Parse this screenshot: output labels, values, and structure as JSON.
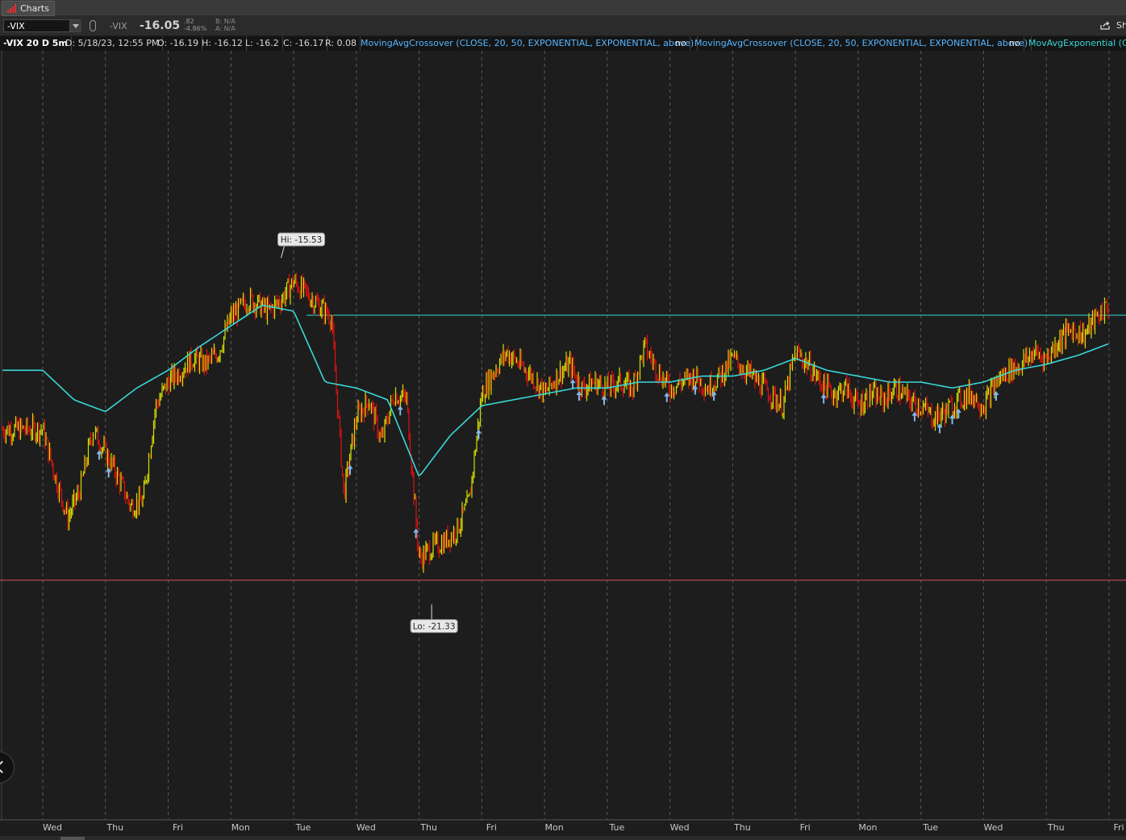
{
  "app": {
    "tab_label": "Charts"
  },
  "toolbar": {
    "symbol_value": "-VIX",
    "symbol_short": "-VIX",
    "last_price": "-16.05",
    "change_abs": ".82",
    "change_pct": "-4.86%",
    "bid": "B: N/A",
    "ask": "A: N/A",
    "share_label": "Sh"
  },
  "legend": {
    "title": "-VIX 20 D 5m",
    "date": "D: 5/18/23, 12:55 PM",
    "open": "O: -16.19",
    "high": "H: -16.12",
    "low": "L: -16.2",
    "close": "C: -16.17",
    "range": "R: 0.08",
    "study1": "MovingAvgCrossover (CLOSE, 20, 50, EXPONENTIAL, EXPONENTIAL, above)",
    "study1_flag": "no",
    "study2": "MovingAvgCrossover (CLOSE, 20, 50, EXPONENTIAL, EXPONENTIAL, above)",
    "study2_flag": "no",
    "study3": "MovAvgExponential (CL"
  },
  "colors": {
    "background": "#1d1d1d",
    "candle_up": "#d4e000",
    "candle_down": "#e01010",
    "moving_average": "#3ad7d7",
    "resistance_line": "#3ad7d7",
    "support_line": "#e05050",
    "signal_arrow": "#7fb8ee",
    "grid": "#5a5a5a"
  },
  "chart_data": {
    "type": "candlestick-line",
    "title": "-VIX 20 D 5m",
    "xlabel": "",
    "ylabel": "",
    "ylim": [
      -25.0,
      -12.0
    ],
    "grid": {
      "vertical_day_separators": true,
      "horizontal": false
    },
    "x_ticks": [
      "Wed",
      "Thu",
      "Fri",
      "Mon",
      "Tue",
      "Wed",
      "Thu",
      "Fri",
      "Mon",
      "Tue",
      "Wed",
      "Thu",
      "Fri",
      "Mon",
      "Tue",
      "Wed",
      "Thu",
      "Fri"
    ],
    "price_series": {
      "name": "-VIX",
      "day_index": [
        0.0,
        0.2,
        0.4,
        0.6,
        0.8,
        1.0,
        1.2,
        1.4,
        1.6,
        1.8,
        2.0,
        2.2,
        2.4,
        2.6,
        2.8,
        3.0,
        3.3,
        3.6,
        3.8,
        4.0,
        4.2,
        4.4,
        4.6,
        4.8,
        5.0,
        5.2,
        5.4,
        5.6,
        5.8,
        6.0,
        6.2,
        6.4,
        6.6,
        6.8,
        7.0,
        7.2,
        7.4,
        7.6,
        7.8,
        8.0,
        8.2,
        8.4,
        8.6,
        8.8,
        9.0,
        9.2,
        9.4,
        9.6,
        9.8,
        10.0,
        10.2,
        10.4,
        10.6,
        10.8,
        11.0,
        11.2,
        11.4,
        11.6,
        11.8,
        12.0,
        12.2,
        12.4,
        12.6,
        12.8,
        13.0,
        13.2,
        13.4,
        13.6,
        13.8,
        14.0,
        14.2,
        14.4,
        14.6,
        14.8,
        15.0,
        15.2,
        15.4,
        15.6,
        15.8,
        16.0,
        16.2,
        16.4,
        16.6,
        16.8,
        17.0
      ],
      "close": [
        -18.4,
        -19.2,
        -19.9,
        -19.4,
        -18.4,
        -18.8,
        -19.2,
        -19.7,
        -19.6,
        -18.0,
        -17.6,
        -17.4,
        -17.2,
        -17.3,
        -17.1,
        -16.5,
        -16.2,
        -16.4,
        -16.2,
        -15.9,
        -16.1,
        -16.3,
        -16.5,
        -19.5,
        -18.2,
        -17.9,
        -18.6,
        -17.8,
        -17.9,
        -20.6,
        -20.4,
        -20.3,
        -20.1,
        -19.6,
        -17.8,
        -17.4,
        -17.1,
        -17.3,
        -17.5,
        -17.8,
        -17.5,
        -17.3,
        -17.7,
        -17.6,
        -17.7,
        -17.6,
        -17.7,
        -17.0,
        -17.4,
        -17.7,
        -17.6,
        -17.5,
        -17.7,
        -17.5,
        -17.2,
        -17.4,
        -17.6,
        -17.8,
        -18.0,
        -17.1,
        -17.3,
        -17.6,
        -17.8,
        -17.7,
        -18.0,
        -17.8,
        -17.9,
        -17.7,
        -17.9,
        -18.0,
        -18.2,
        -18.1,
        -17.9,
        -17.8,
        -18.0,
        -17.6,
        -17.4,
        -17.3,
        -17.1,
        -17.2,
        -16.9,
        -16.7,
        -16.8,
        -16.5,
        -16.3
      ]
    },
    "moving_average": {
      "name": "MovAvgExponential",
      "day_index": [
        0,
        0.5,
        1,
        1.5,
        2,
        2.5,
        3,
        3.5,
        4,
        4.5,
        5,
        5.5,
        6,
        6.5,
        7,
        7.5,
        8,
        8.5,
        9,
        9.5,
        10,
        10.5,
        11,
        11.5,
        12,
        12.5,
        13,
        13.5,
        14,
        14.5,
        15,
        15.5,
        16,
        16.5,
        17
      ],
      "values": [
        -17.4,
        -17.9,
        -18.1,
        -17.7,
        -17.4,
        -17.0,
        -16.65,
        -16.3,
        -16.4,
        -17.6,
        -17.7,
        -17.9,
        -19.2,
        -18.5,
        -18.0,
        -17.9,
        -17.8,
        -17.7,
        -17.7,
        -17.6,
        -17.6,
        -17.5,
        -17.5,
        -17.4,
        -17.2,
        -17.4,
        -17.5,
        -17.6,
        -17.6,
        -17.7,
        -17.6,
        -17.4,
        -17.3,
        -17.15,
        -16.95
      ]
    },
    "horizontal_lines": [
      {
        "value": -16.47
      },
      {
        "value": -20.95
      }
    ],
    "annotations": [
      {
        "label": "Hi: -15.53",
        "value": -15.53,
        "day_index": 3.8
      },
      {
        "label": "Lo: -21.33",
        "value": -21.33,
        "day_index": 6.2
      }
    ],
    "signals": [
      0.9,
      1.05,
      4.9,
      5.7,
      5.95,
      6.95,
      8.45,
      8.55,
      8.95,
      9.95,
      10.4,
      10.7,
      12.45,
      13.9,
      14.3,
      14.5,
      14.6,
      15.2
    ]
  }
}
